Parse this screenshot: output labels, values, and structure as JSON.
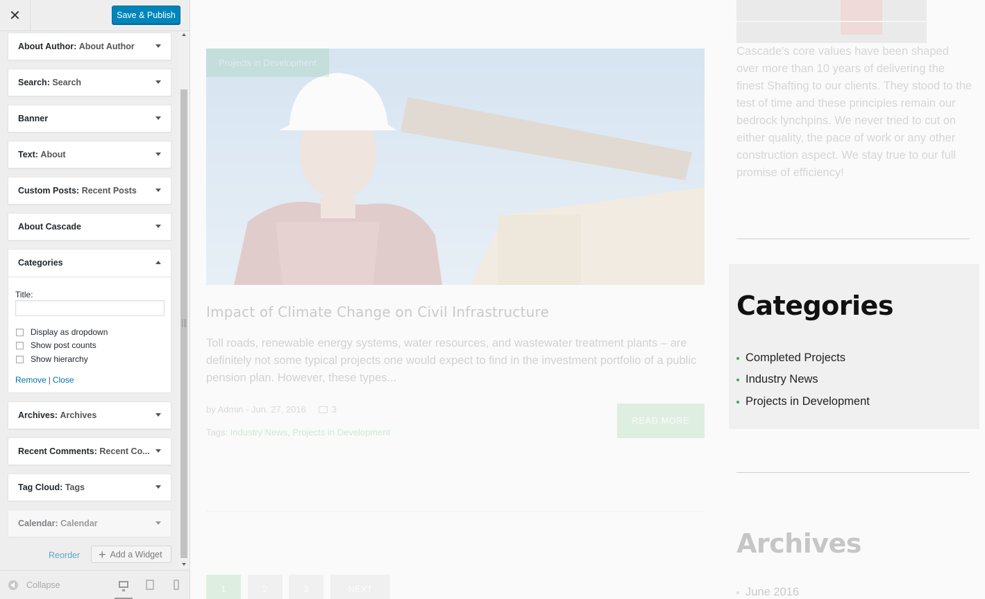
{
  "customizer": {
    "publish_label": "Save & Publish",
    "widgets": [
      {
        "type": "About Author:",
        "title": "About Author"
      },
      {
        "type": "Search:",
        "title": "Search"
      },
      {
        "type": "Banner",
        "title": ""
      },
      {
        "type": "Text:",
        "title": "About"
      },
      {
        "type": "Custom Posts:",
        "title": "Recent Posts"
      },
      {
        "type": "About Cascade",
        "title": ""
      },
      {
        "type": "Archives:",
        "title": "Archives"
      },
      {
        "type": "Recent Comments:",
        "title": "Recent Co..."
      },
      {
        "type": "Tag Cloud:",
        "title": "Tags"
      },
      {
        "type": "Calendar:",
        "title": "Calendar"
      }
    ],
    "categories_widget": {
      "heading": "Categories",
      "title_label": "Title:",
      "title_value": "",
      "options": [
        "Display as dropdown",
        "Show post counts",
        "Show hierarchy"
      ],
      "remove_label": "Remove",
      "separator": "|",
      "close_label": "Close"
    },
    "reorder_label": "Reorder",
    "add_widget_label": "Add a Widget",
    "collapse_label": "Collapse"
  },
  "preview": {
    "post": {
      "badge": "Projects in Development",
      "title": "Impact of Climate Change on Civil Infrastructure",
      "excerpt": "Toll roads, renewable energy systems, water resources, and wastewater treatment plants – are definitely not some typical projects one would expect to find in the investment portfolio of a public pension plan. However, these types...",
      "meta_byline": "by Admin - Jun. 27, 2016",
      "comment_count": "3",
      "tags_label": "Tags:",
      "tags": [
        "Industry News",
        "Projects in Development"
      ],
      "read_more": "READ MORE"
    },
    "pagination": [
      "1",
      "2",
      "3",
      "NEXT"
    ],
    "about_text": "Cascade's core values have been shaped over more than 10 years of delivering the finest Shafting to our clients. They stood to the test of time and these principles remain our bedrock lynchpins. We never tried to cut on either quality, the pace of work or any other construction aspect. We stay true to our full promise of efficiency!",
    "categories_title": "Categories",
    "categories": [
      "Completed Projects",
      "Industry News",
      "Projects in Development"
    ],
    "archives_title": "Archives",
    "archives": [
      "June 2016"
    ]
  },
  "colors": {
    "primary_button": "#0085ba",
    "accent_green": "#7fca8f",
    "link_blue": "#0073aa"
  }
}
